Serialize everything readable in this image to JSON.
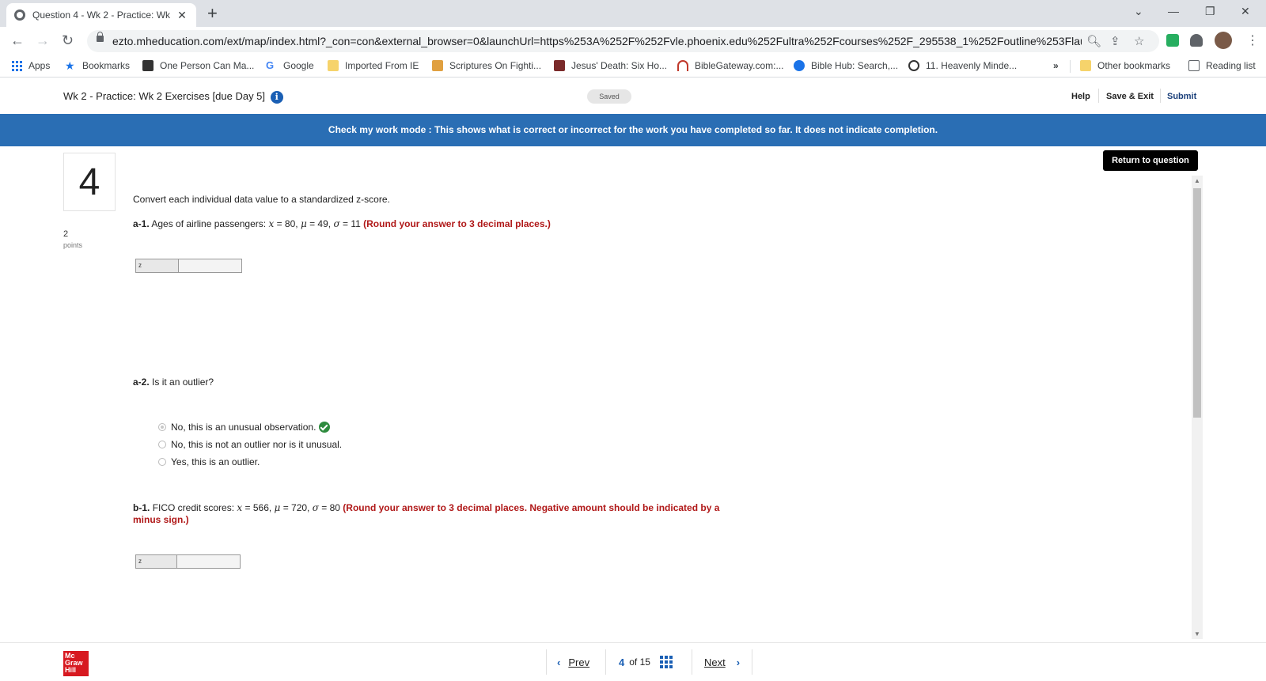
{
  "browser": {
    "tab_title": "Question 4 - Wk 2 - Practice: Wk",
    "tab_close": "✕",
    "new_tab": "+",
    "url": "ezto.mheducation.com/ext/map/index.html?_con=con&external_browser=0&launchUrl=https%253A%252F%252Fvle.phoenix.edu%252Fultra%252Fcourses%252F_295538_1%252Foutline%253Flau...",
    "window_controls": {
      "dropdown": "⌄",
      "minimize": "—",
      "restore": "❐",
      "close": "✕"
    },
    "nav": {
      "back": "←",
      "forward": "→",
      "reload": "↻"
    }
  },
  "bookmarks": [
    {
      "label": "Apps",
      "icon": "apps-icon"
    },
    {
      "label": "Bookmarks",
      "icon": "star-icon",
      "color": "#1a73e8"
    },
    {
      "label": "One Person Can Ma...",
      "icon": "lead-icon",
      "color": "#333333"
    },
    {
      "label": "Google",
      "icon": "google-icon",
      "color": "#4285f4"
    },
    {
      "label": "Imported From IE",
      "icon": "folder-icon",
      "color": "#f6d36b"
    },
    {
      "label": "Scriptures On Fighti...",
      "icon": "folder-icon",
      "color": "#e0a040"
    },
    {
      "label": "Jesus' Death: Six Ho...",
      "icon": "page-icon",
      "color": "#7a2a2a"
    },
    {
      "label": "BibleGateway.com:...",
      "icon": "biblegateway-icon",
      "color": "#c0392b"
    },
    {
      "label": "Bible Hub: Search,...",
      "icon": "biblehub-icon",
      "color": "#1a73e8"
    },
    {
      "label": "11. Heavenly Minde...",
      "icon": "clock-icon",
      "color": "#333333"
    }
  ],
  "bookmarks_more": "»",
  "other_bookmarks": "Other bookmarks",
  "reading_list": "Reading list",
  "header": {
    "assignment_title": "Wk 2 - Practice: Wk 2 Exercises [due Day 5]",
    "info": "i",
    "saved_label": "Saved",
    "help": "Help",
    "save_exit": "Save & Exit",
    "submit": "Submit"
  },
  "banner_text": "Check my work mode : This shows what is correct or incorrect for the work you have completed so far. It does not indicate completion.",
  "question": {
    "number": "4",
    "points_value": "2",
    "points_label": "points",
    "return_label": "Return to question",
    "prompt": "Convert each individual data value to a standardized z-score.",
    "a1": {
      "label": "a-1.",
      "text": "Ages of airline passengers:",
      "x_sym": "x",
      "x_eq": " = 80, ",
      "mu_sym": "μ",
      "mu_eq": " = 49, ",
      "sigma_sym": "σ",
      "sigma_eq": " = 11 ",
      "instruction": "(Round your answer to 3 decimal places.)",
      "answer_label": "z",
      "answer_value": ""
    },
    "a2": {
      "label": "a-2.",
      "text": "Is it an outlier?",
      "options": [
        {
          "label": "No, this is an unusual observation.",
          "selected": true,
          "correct": true
        },
        {
          "label": "No, this is not an outlier nor is it unusual.",
          "selected": false
        },
        {
          "label": "Yes, this is an outlier.",
          "selected": false
        }
      ]
    },
    "b1": {
      "label": "b-1.",
      "text": "FICO credit scores:",
      "x_sym": "x",
      "x_eq": " = 566, ",
      "mu_sym": "μ",
      "mu_eq": " = 720, ",
      "sigma_sym": "σ",
      "sigma_eq": " = 80 ",
      "instruction_line1": "(Round your answer to 3 decimal places. Negative amount should be indicated by a",
      "instruction_line2": "minus sign.)",
      "answer_label": "z",
      "answer_value": ""
    }
  },
  "footer": {
    "logo": "Mc Graw Hill",
    "prev": "Prev",
    "current": "4",
    "of_label": "of 15",
    "next": "Next"
  },
  "colors": {
    "banner": "#2a6eb4",
    "instruction_red": "#b01818",
    "check_green": "#2e8b3e",
    "logo_red": "#d71920"
  }
}
